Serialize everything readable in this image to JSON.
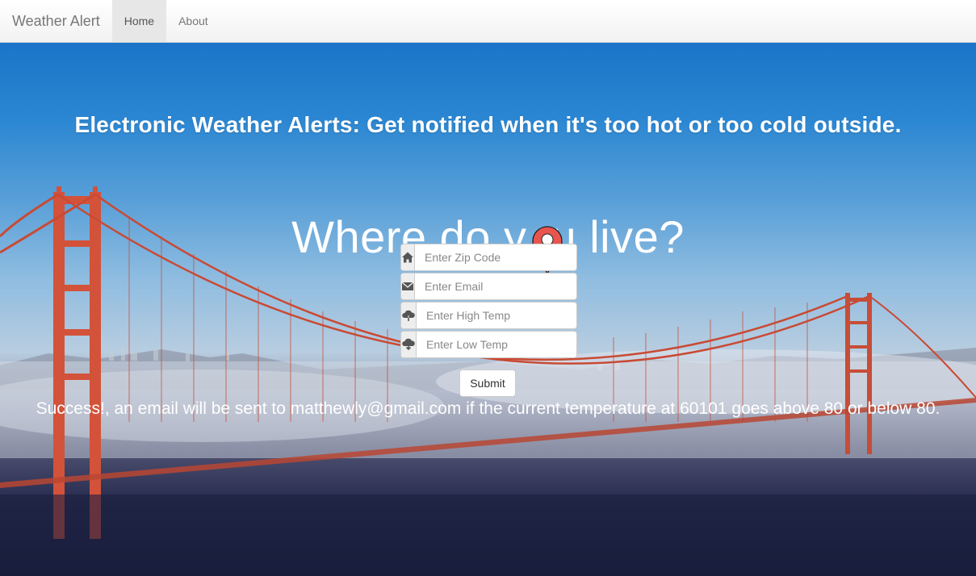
{
  "navbar": {
    "brand": "Weather Alert",
    "items": [
      {
        "label": "Home",
        "active": true
      },
      {
        "label": "About",
        "active": false
      }
    ]
  },
  "hero": {
    "headline": "Electronic Weather Alerts: Get notified when it's too hot or too cold outside.",
    "question_part1": "Where do y",
    "question_part2": "u live?"
  },
  "form": {
    "fields": [
      {
        "icon": "home-icon",
        "placeholder": "Enter Zip Code"
      },
      {
        "icon": "envelope-icon",
        "placeholder": "Enter Email"
      },
      {
        "icon": "cloud-upload-icon",
        "placeholder": "Enter High Temp"
      },
      {
        "icon": "cloud-download-icon",
        "placeholder": "Enter Low Temp"
      }
    ],
    "submit_label": "Submit"
  },
  "status": {
    "message": "Success!, an email will be sent to matthewly@gmail.com if the current temperature at 60101 goes above 80 or below 80."
  },
  "colors": {
    "bridge": "#d3523a",
    "pin": "#e8554e",
    "sky_top": "#1b74c8",
    "bottom": "#151a38"
  }
}
